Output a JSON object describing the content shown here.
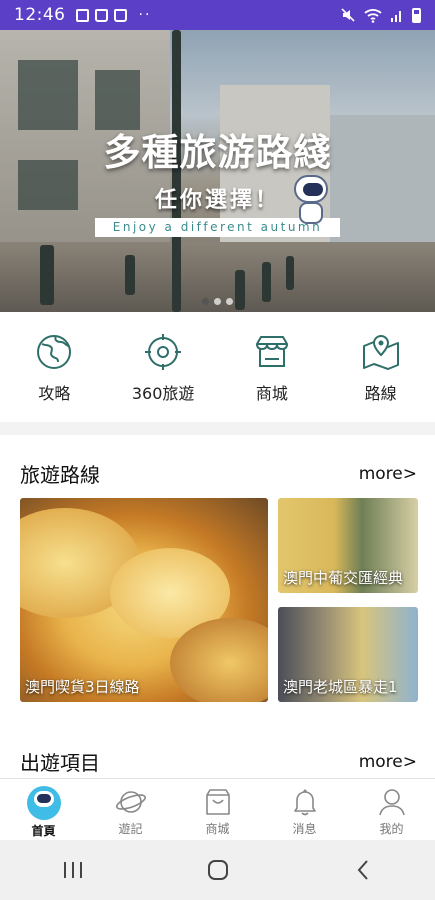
{
  "status_bar": {
    "time": "12:46",
    "dots": "··"
  },
  "banner": {
    "title": "多種旅游路綫",
    "subtitle": "任你選擇！",
    "tagline": "Enjoy a different autumn",
    "slide_count": 3,
    "active_slide": 1
  },
  "quick_menu": [
    {
      "label": "攻略",
      "icon": "globe-icon"
    },
    {
      "label": "360旅遊",
      "icon": "360-view-icon"
    },
    {
      "label": "商城",
      "icon": "shop-icon"
    },
    {
      "label": "路線",
      "icon": "map-route-icon"
    }
  ],
  "routes_section": {
    "title": "旅遊路線",
    "more": "more>",
    "cards": [
      {
        "caption": "澳門喫貨3日線路"
      },
      {
        "caption": "澳門中葡交匯經典"
      },
      {
        "caption": "澳門老城區暴走1"
      }
    ]
  },
  "trips_section": {
    "title": "出遊項目",
    "more": "more>"
  },
  "tabbar": [
    {
      "label": "首頁",
      "icon": "home-robot-icon",
      "active": true
    },
    {
      "label": "遊記",
      "icon": "planet-icon",
      "active": false
    },
    {
      "label": "商城",
      "icon": "shopping-bag-icon",
      "active": false
    },
    {
      "label": "消息",
      "icon": "bell-icon",
      "active": false
    },
    {
      "label": "我的",
      "icon": "user-icon",
      "active": false
    }
  ],
  "colors": {
    "accent": "#2f6f6a",
    "status_bar": "#5b3fc7",
    "robot": "#3fbde6"
  }
}
